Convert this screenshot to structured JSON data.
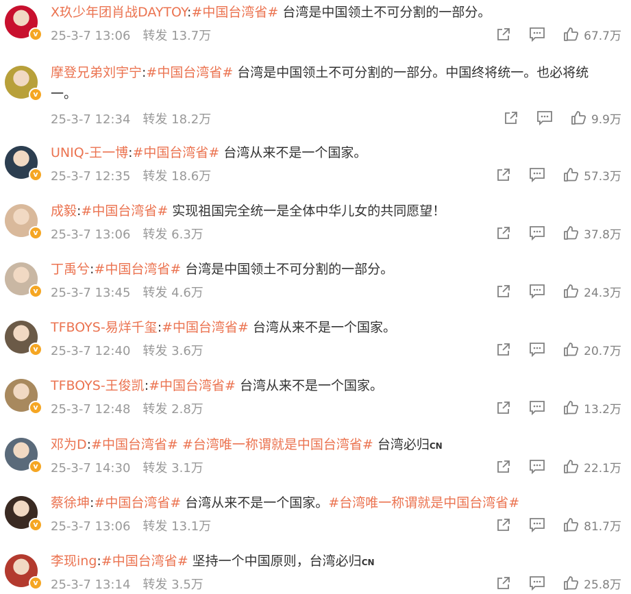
{
  "icons": {
    "share": "share-icon",
    "comment": "comment-icon",
    "like": "thumbs-up-icon",
    "verified": "verified-badge-icon"
  },
  "colors": {
    "username": "#eb7350",
    "hashtag": "#eb7350",
    "meta": "#999999",
    "badge": "#f5a623"
  },
  "labels": {
    "repost": "转发",
    "verified": "v"
  },
  "comments": [
    {
      "name": "X玖少年团肖战DAYTOY",
      "colon": ":",
      "tags": [
        "#中国台湾省#"
      ],
      "text": " 台湾是中国领土不可分割的一部分。",
      "text2": "",
      "time": "25-3-7 13:06",
      "reposts": "13.7万",
      "likes": "67.7万",
      "avatar": "#c8102e"
    },
    {
      "name": "摩登兄弟刘宇宁",
      "colon": ":",
      "tags": [
        "#中国台湾省#"
      ],
      "text": " 台湾是中国领土不可分割的一部分。中国终将统一。也必将统",
      "text2": "一。",
      "time": "25-3-7 12:34",
      "reposts": "18.2万",
      "likes": "9.9万",
      "avatar": "#b8a03a"
    },
    {
      "name": "UNIQ-王一博",
      "colon": ":",
      "tags": [
        "#中国台湾省#"
      ],
      "text": " 台湾从来不是一个国家。",
      "text2": "",
      "time": "25-3-7 12:35",
      "reposts": "18.6万",
      "likes": "57.3万",
      "avatar": "#2c3e50"
    },
    {
      "name": "成毅",
      "colon": ":",
      "tags": [
        "#中国台湾省#"
      ],
      "text": " 实现祖国完全统一是全体中华儿女的共同愿望！",
      "text2": "",
      "time": "25-3-7 13:06",
      "reposts": "6.3万",
      "likes": "37.8万",
      "avatar": "#d9b99b"
    },
    {
      "name": "丁禹兮",
      "colon": ":",
      "tags": [
        "#中国台湾省#"
      ],
      "text": " 台湾是中国领土不可分割的一部分。",
      "text2": "",
      "time": "25-3-7 13:45",
      "reposts": "4.6万",
      "likes": "24.3万",
      "avatar": "#c9b7a3"
    },
    {
      "name": "TFBOYS-易烊千玺",
      "colon": ":",
      "tags": [
        "#中国台湾省#"
      ],
      "text": " 台湾从来不是一个国家。",
      "text2": "",
      "time": "25-3-7 12:40",
      "reposts": "3.6万",
      "likes": "20.7万",
      "avatar": "#6b5a47"
    },
    {
      "name": "TFBOYS-王俊凯",
      "colon": ":",
      "tags": [
        "#中国台湾省#"
      ],
      "text": " 台湾从来不是一个国家。",
      "text2": "",
      "time": "25-3-7 12:48",
      "reposts": "2.8万",
      "likes": "13.2万",
      "avatar": "#a8895e"
    },
    {
      "name": "邓为D",
      "colon": ":",
      "tags": [
        "#中国台湾省#",
        "#台湾唯一称谓就是中国台湾省#"
      ],
      "text": " 台湾必归",
      "cn": "CN",
      "text2": "",
      "time": "25-3-7 14:30",
      "reposts": "3.1万",
      "likes": "22.1万",
      "avatar": "#5a6a7a"
    },
    {
      "name": "蔡徐坤",
      "colon": ":",
      "tags": [
        "#中国台湾省#"
      ],
      "text": " 台湾从来不是一个国家。",
      "tagAfter": "#台湾唯一称谓就是中国台湾省#",
      "text2": "",
      "time": "25-3-7 13:06",
      "reposts": "13.1万",
      "likes": "81.7万",
      "avatar": "#3a2a22"
    },
    {
      "name": "李现ing",
      "colon": ":",
      "tags": [
        "#中国台湾省#"
      ],
      "text": " 坚持一个中国原则，台湾必归",
      "cn": "CN",
      "text2": "",
      "time": "25-3-7 13:14",
      "reposts": "3.5万",
      "likes": "25.8万",
      "avatar": "#b33a2e"
    }
  ]
}
